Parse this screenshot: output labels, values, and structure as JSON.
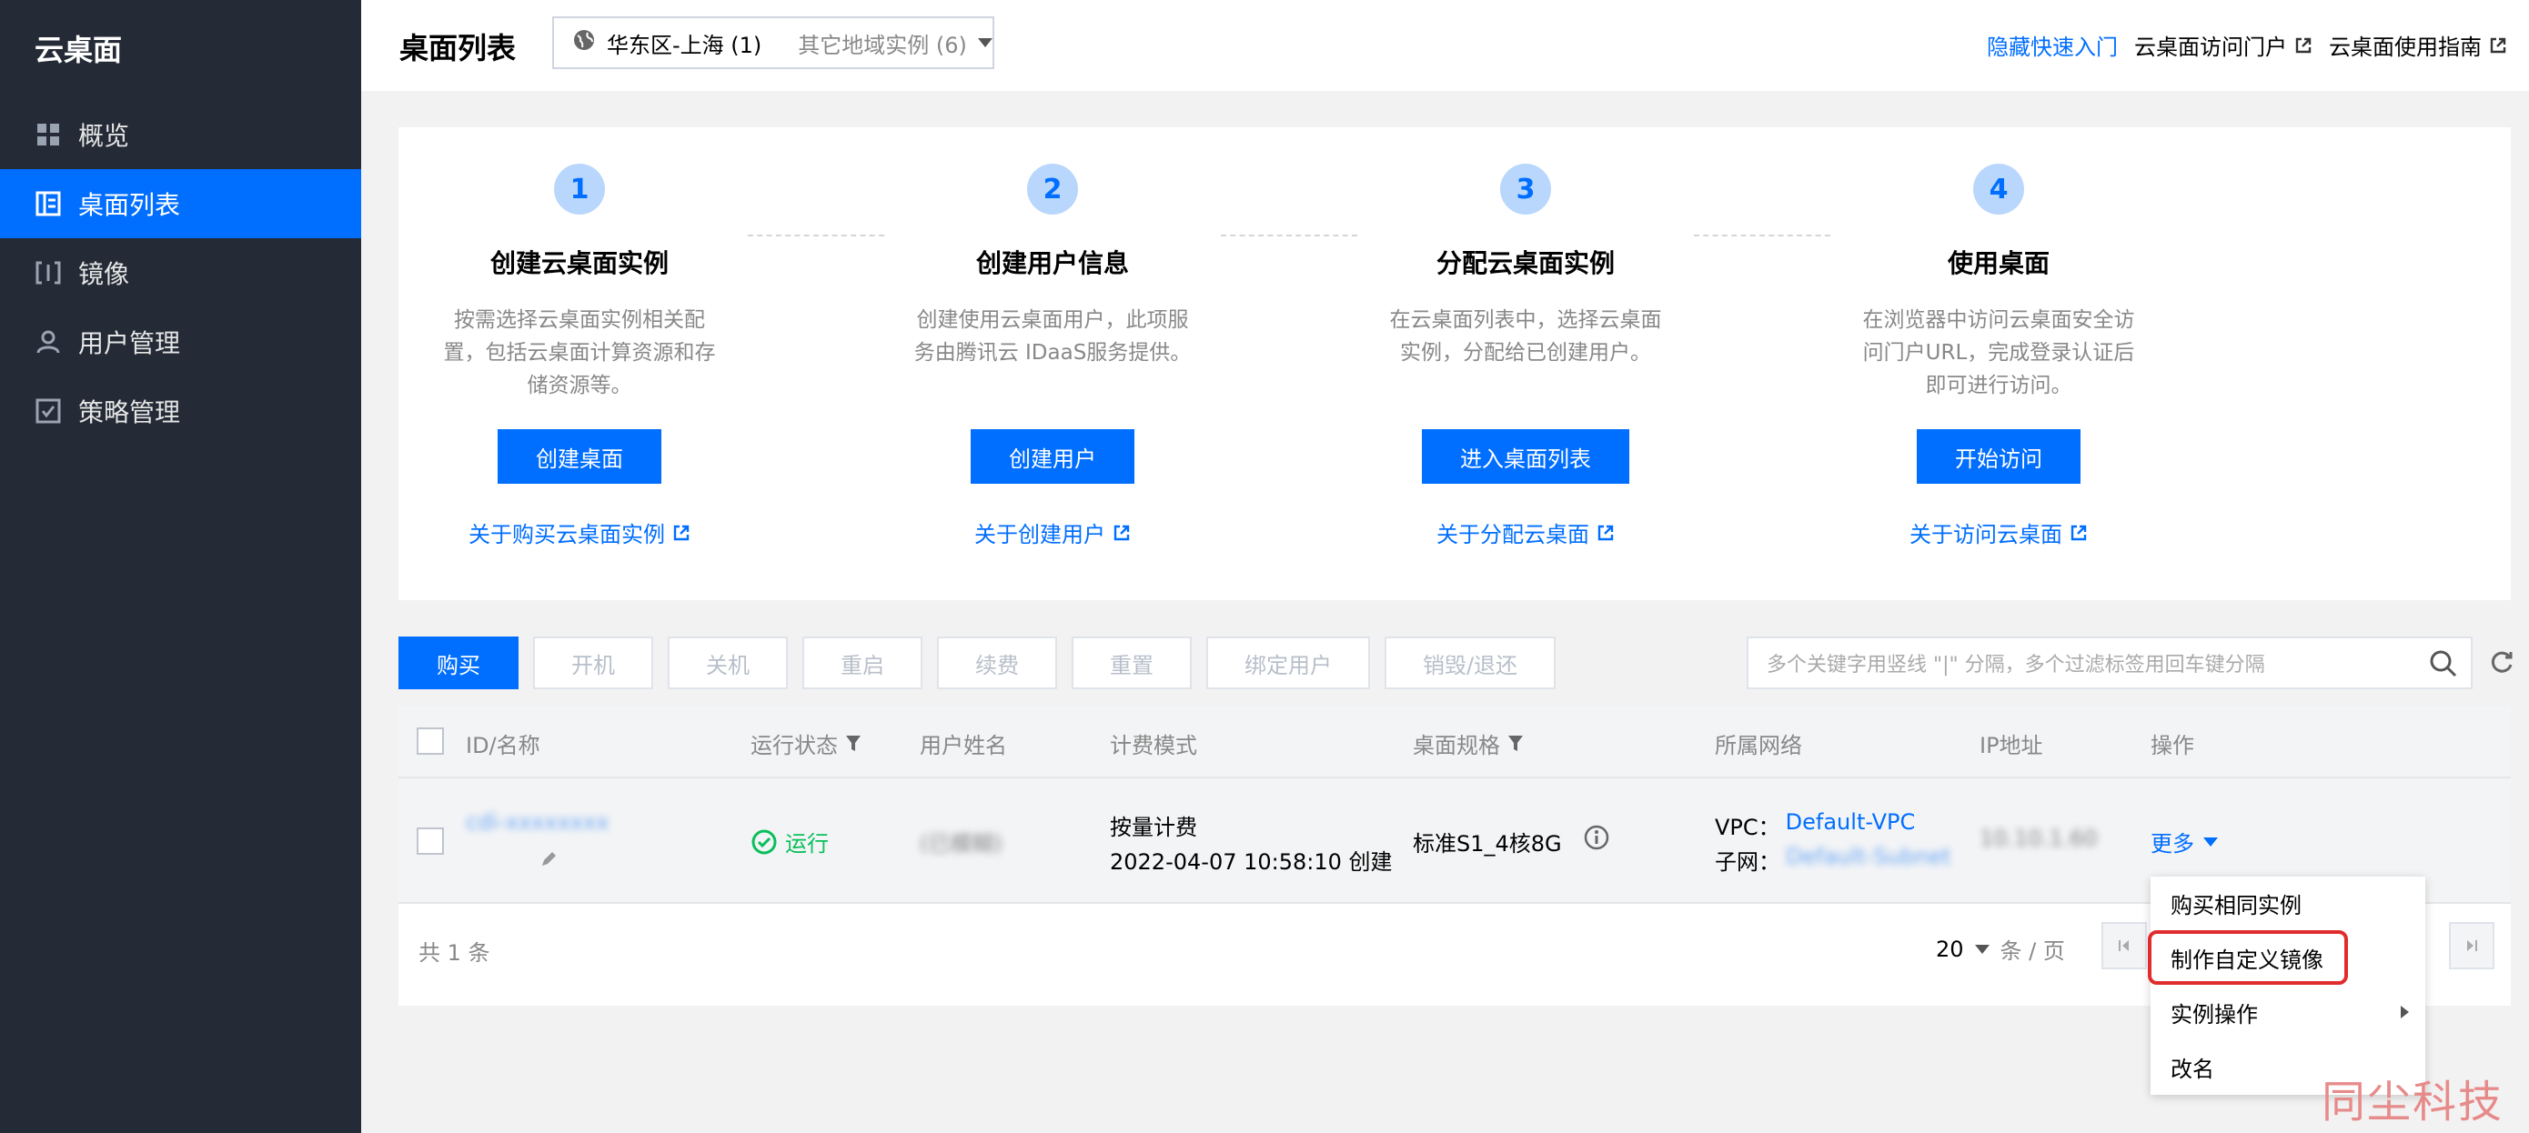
{
  "sidebar": {
    "brand": "云桌面",
    "items": [
      {
        "label": "概览",
        "icon": "grid-icon"
      },
      {
        "label": "桌面列表",
        "icon": "list-icon",
        "active": true
      },
      {
        "label": "镜像",
        "icon": "image-icon"
      },
      {
        "label": "用户管理",
        "icon": "user-icon"
      },
      {
        "label": "策略管理",
        "icon": "policy-icon"
      }
    ]
  },
  "header": {
    "title": "桌面列表",
    "region": "华东区-上海 (1)",
    "other_regions": "其它地域实例 (6)",
    "links": {
      "hide_guide": "隐藏快速入门",
      "portal": "云桌面访问门户",
      "guide": "云桌面使用指南"
    }
  },
  "guide": {
    "steps": [
      {
        "num": "1",
        "title": "创建云桌面实例",
        "desc": [
          "按需选择云桌面实例相关配",
          "置，包括云桌面计算资源和存",
          "储资源等。"
        ],
        "button": "创建桌面",
        "link": "关于购买云桌面实例"
      },
      {
        "num": "2",
        "title": "创建用户信息",
        "desc": [
          "创建使用云桌面用户，此项服",
          "务由腾讯云 IDaaS服务提供。",
          ""
        ],
        "button": "创建用户",
        "link": "关于创建用户"
      },
      {
        "num": "3",
        "title": "分配云桌面实例",
        "desc": [
          "在云桌面列表中，选择云桌面",
          "实例，分配给已创建用户。",
          ""
        ],
        "button": "进入桌面列表",
        "link": "关于分配云桌面"
      },
      {
        "num": "4",
        "title": "使用桌面",
        "desc": [
          "在浏览器中访问云桌面安全访",
          "问门户URL，完成登录认证后",
          "即可进行访问。"
        ],
        "button": "开始访问",
        "link": "关于访问云桌面"
      }
    ]
  },
  "toolbar": {
    "buttons": [
      "购买",
      "开机",
      "关机",
      "重启",
      "续费",
      "重置",
      "绑定用户",
      "销毁/退还"
    ],
    "search_placeholder": "多个关键字用竖线 \"|\" 分隔，多个过滤标签用回车键分隔"
  },
  "table": {
    "headers": [
      "ID/名称",
      "运行状态",
      "用户姓名",
      "计费模式",
      "桌面规格",
      "所属网络",
      "IP地址",
      "操作"
    ],
    "row": {
      "id": "cdi-xxxxxxxx",
      "status": "运行",
      "user": "(已模糊)",
      "billing_mode": "按量计费",
      "created": "2022-04-07 10:58:10 创建",
      "spec": "标准S1_4核8G",
      "vpc_label": "VPC：",
      "vpc": "Default-VPC",
      "subnet_label": "子网：",
      "subnet": "Default-Subnet",
      "ip": "10.10.1.60",
      "action": "更多"
    },
    "total": "共 1 条",
    "page_size": "20",
    "page_unit": "条 / 页"
  },
  "dropdown": {
    "items": [
      "购买相同实例",
      "制作自定义镜像",
      "实例操作",
      "改名"
    ],
    "highlighted": "制作自定义镜像"
  },
  "watermark": "同尘科技",
  "colors": {
    "primary": "#006eff",
    "sidebar_bg": "#242a36",
    "running": "#0abf5b",
    "highlight": "#e02c2c"
  }
}
